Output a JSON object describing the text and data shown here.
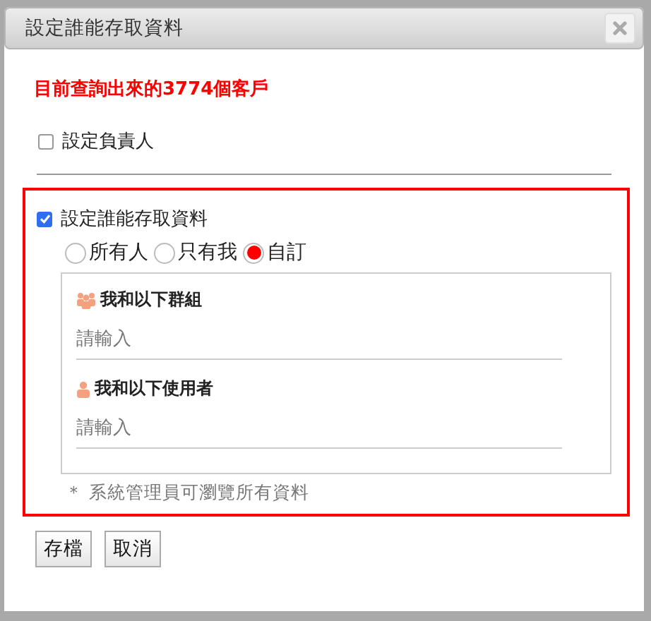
{
  "dialog": {
    "title": "設定誰能存取資料",
    "notice": "目前查詢出來的3774個客戶",
    "owner_option": {
      "label": "設定負責人",
      "checked": false
    },
    "access_option": {
      "label": "設定誰能存取資料",
      "checked": true
    },
    "scopes": [
      {
        "label": "所有人",
        "selected": false
      },
      {
        "label": "只有我",
        "selected": false
      },
      {
        "label": "自訂",
        "selected": true
      }
    ],
    "custom_fields": [
      {
        "kind": "group",
        "label": "我和以下群組",
        "placeholder": "請輸入"
      },
      {
        "kind": "user",
        "label": "我和以下使用者",
        "placeholder": "請輸入"
      }
    ],
    "note": "＊ 系統管理員可瀏覽所有資料",
    "buttons": [
      {
        "label": "存檔"
      },
      {
        "label": "取消"
      }
    ]
  }
}
